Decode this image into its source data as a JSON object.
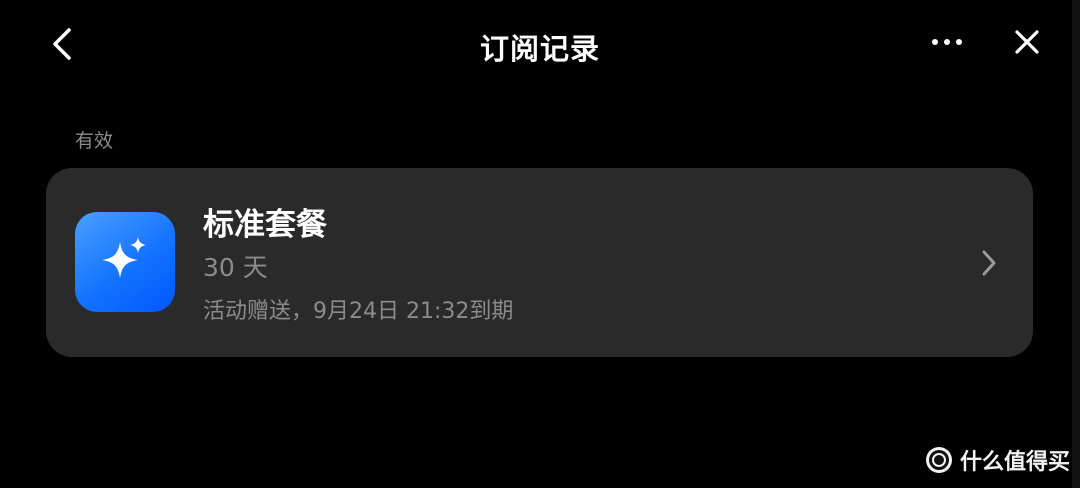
{
  "header": {
    "title": "订阅记录",
    "back_icon": "chevron-left-icon",
    "more_icon": "more-horizontal-icon",
    "close_icon": "close-icon"
  },
  "section": {
    "label": "有效"
  },
  "subscription": {
    "name": "标准套餐",
    "duration": "30 天",
    "expiry": "活动赠送，9月24日 21:32到期",
    "icon": "sparkle-icon",
    "chevron_icon": "chevron-right-icon"
  },
  "watermark": {
    "text": "什么值得买",
    "logo": "smzdm-logo"
  },
  "colors": {
    "background": "#000000",
    "card": "#2a2a2b",
    "muted_text": "#8b8b8b",
    "icon_blue": "#1473ff"
  }
}
